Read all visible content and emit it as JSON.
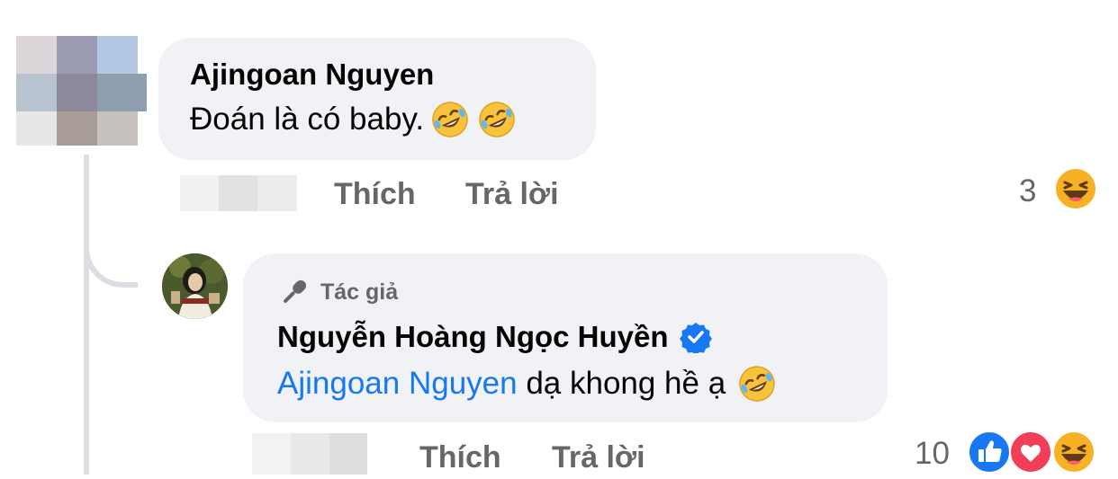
{
  "comment1": {
    "author": "Ajingoan Nguyen",
    "text": "Đoán là có baby.",
    "actions": {
      "like": "Thích",
      "reply": "Trả lời"
    },
    "reaction_count": "3",
    "reaction_icons": [
      "haha-face-icon"
    ]
  },
  "reply1": {
    "author_badge_label": "Tác giả",
    "author_badge_icon": "microphone-icon",
    "author": "Nguyễn Hoàng Ngọc Huyền",
    "verified_icon": "verified-badge-icon",
    "mention": "Ajingoan Nguyen",
    "text": " dạ khong hề ạ",
    "actions": {
      "like": "Thích",
      "reply": "Trả lời"
    },
    "reaction_count": "10",
    "reaction_icons": [
      "like-icon",
      "love-icon",
      "haha-face-icon"
    ]
  },
  "colors": {
    "bubble_bg": "#f0f2f5",
    "action_gray": "#65676b",
    "mention_blue": "#1877f2",
    "like_blue": "#1877f2",
    "love_red": "#f33e58",
    "emoji_yellow": "#f7b125"
  }
}
